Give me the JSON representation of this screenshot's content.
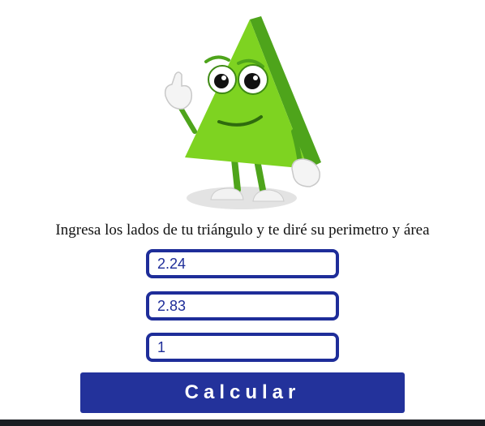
{
  "prompt_text": "Ingresa los lados de tu triángulo y te diré su perimetro y área",
  "inputs": {
    "side_a": {
      "value": "2.24"
    },
    "side_b": {
      "value": "2.83"
    },
    "side_c": {
      "value": "1"
    }
  },
  "calculate_label": "Calcular",
  "colors": {
    "accent": "#23329b",
    "input_border": "#1e2d99",
    "mascot_green": "#7ed321",
    "mascot_dark_green": "#4ea41b"
  },
  "mascot": {
    "icon": "triangle-mascot-icon"
  }
}
